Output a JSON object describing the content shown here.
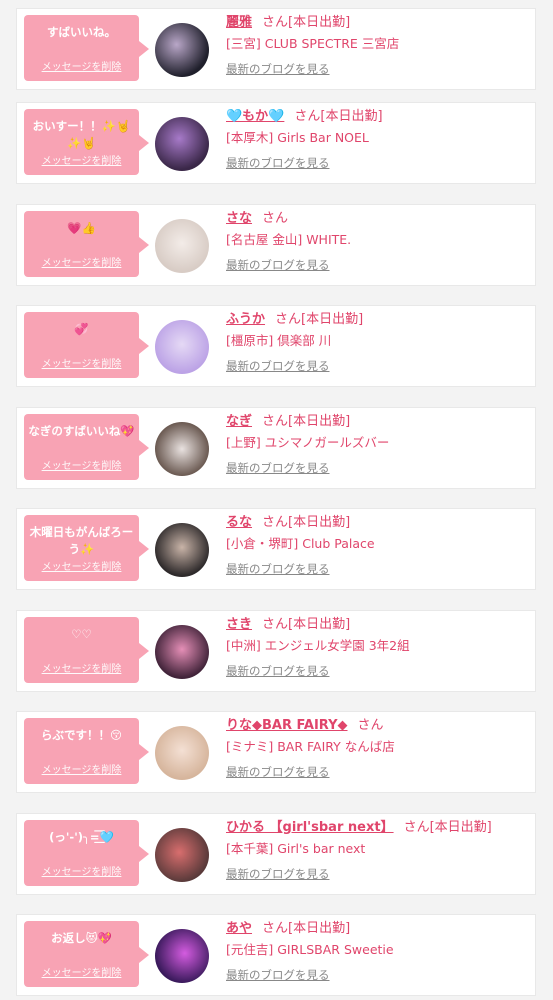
{
  "delete_label": "メッセージを削除",
  "blog_label": "最新のブログを見る",
  "items": [
    {
      "message": "すばいいね。",
      "name": "麗雅",
      "suffix": "さん[本日出勤]",
      "shop": "[三宮] CLUB SPECTRE 三宮店",
      "avatar_colors": [
        "#1f1f2b",
        "#b9a7c8"
      ]
    },
    {
      "message": "おいすー！！✨🤘✨🤘",
      "name": "🩵もか🩵",
      "suffix": "さん[本日出勤]",
      "shop": "[本厚木] Girls Bar NOEL",
      "avatar_colors": [
        "#3a2748",
        "#a77ac9"
      ]
    },
    {
      "message": "💗👍",
      "name": "さな",
      "suffix": "さん",
      "shop": "[名古屋 金山] WHITE.",
      "avatar_colors": [
        "#d8ccc5",
        "#f3ece8"
      ]
    },
    {
      "message": "💞",
      "name": "ふうか",
      "suffix": "さん[本日出勤]",
      "shop": "[橿原市] 倶楽部 川",
      "avatar_colors": [
        "#e5d9f5",
        "#bca3e6"
      ]
    },
    {
      "message": "なぎのすばいいね💖",
      "name": "なぎ",
      "suffix": "さん[本日出勤]",
      "shop": "[上野] ユシマノガールズバー",
      "avatar_colors": [
        "#6b5a52",
        "#e9e2e0"
      ]
    },
    {
      "message": "木曜日もがんばろーう✨",
      "name": "るな",
      "suffix": "さん[本日出勤]",
      "shop": "[小倉・堺町] Club Palace",
      "avatar_colors": [
        "#2e2a2b",
        "#c9b4a8"
      ]
    },
    {
      "message": "♡♡",
      "name": "さき",
      "suffix": "さん[本日出勤]",
      "shop": "[中洲] エンジェル女学園 3年2組",
      "avatar_colors": [
        "#42243a",
        "#e58fb7"
      ]
    },
    {
      "message": "らぶです！！😚",
      "name": "りな◆BAR FAIRY◆",
      "suffix": "さん",
      "shop": "[ミナミ] BAR FAIRY なんば店",
      "avatar_colors": [
        "#d6b59c",
        "#f4e0d4"
      ]
    },
    {
      "message": "(っ'-')╮=͟͟͞͞🩵",
      "name": "ひかる 【girl'sbar next】",
      "suffix": "さん[本日出勤]",
      "shop": "[本千葉] Girl's bar next",
      "avatar_colors": [
        "#5a3a3a",
        "#d86e6e"
      ]
    },
    {
      "message": "お返し😻💖",
      "name": "あや",
      "suffix": "さん[本日出勤]",
      "shop": "[元住吉] GIRLSBAR Sweetie",
      "avatar_colors": [
        "#3a1a5c",
        "#d45ce0"
      ]
    }
  ]
}
